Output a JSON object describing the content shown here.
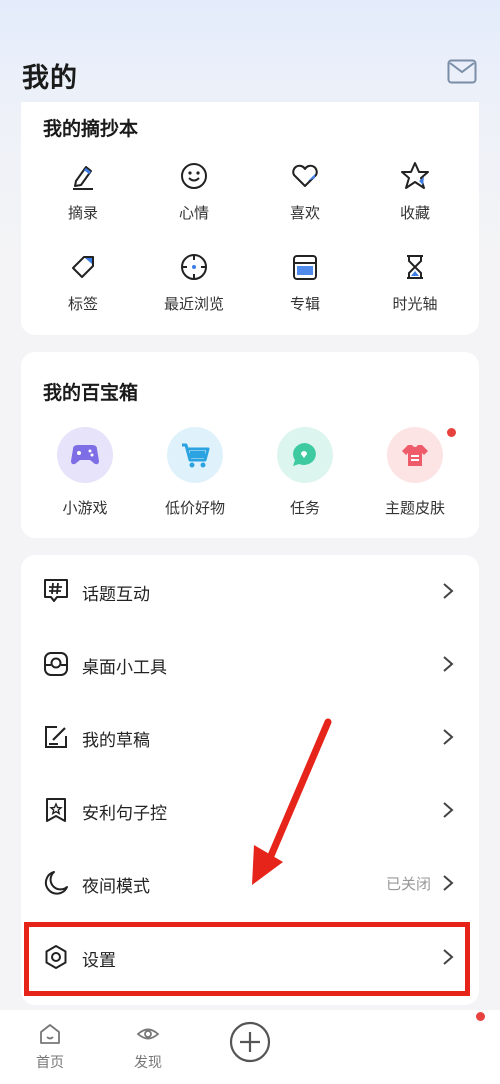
{
  "header": {
    "title": "我的"
  },
  "notebook": {
    "title": "我的摘抄本",
    "items": [
      {
        "label": "摘录",
        "icon": "pencil-icon"
      },
      {
        "label": "心情",
        "icon": "smile-icon"
      },
      {
        "label": "喜欢",
        "icon": "heart-icon"
      },
      {
        "label": "收藏",
        "icon": "star-icon"
      },
      {
        "label": "标签",
        "icon": "tag-icon"
      },
      {
        "label": "最近浏览",
        "icon": "compass-icon"
      },
      {
        "label": "专辑",
        "icon": "album-icon"
      },
      {
        "label": "时光轴",
        "icon": "hourglass-icon"
      }
    ]
  },
  "toolbox": {
    "title": "我的百宝箱",
    "items": [
      {
        "label": "小游戏",
        "icon": "gamepad-icon",
        "color": "#e6e3fb"
      },
      {
        "label": "低价好物",
        "icon": "cart-icon",
        "color": "#dff2fb"
      },
      {
        "label": "任务",
        "icon": "chat-bubble-icon",
        "color": "#dcf5ee"
      },
      {
        "label": "主题皮肤",
        "icon": "tshirt-icon",
        "color": "#fde4e4"
      }
    ]
  },
  "menu": [
    {
      "label": "话题互动",
      "icon": "hashtag-icon",
      "value": ""
    },
    {
      "label": "桌面小工具",
      "icon": "widget-icon",
      "value": ""
    },
    {
      "label": "我的草稿",
      "icon": "draft-icon",
      "value": ""
    },
    {
      "label": "安利句子控",
      "icon": "bookmark-star-icon",
      "value": ""
    },
    {
      "label": "夜间模式",
      "icon": "moon-icon",
      "value": "已关闭"
    },
    {
      "label": "设置",
      "icon": "gear-icon",
      "value": ""
    }
  ],
  "tabbar": {
    "items": [
      {
        "label": "首页",
        "icon": "home-icon"
      },
      {
        "label": "发现",
        "icon": "eye-icon"
      }
    ]
  },
  "colors": {
    "accent": "#3d7de8",
    "highlight": "#e6241a",
    "badge": "#e8423f"
  }
}
